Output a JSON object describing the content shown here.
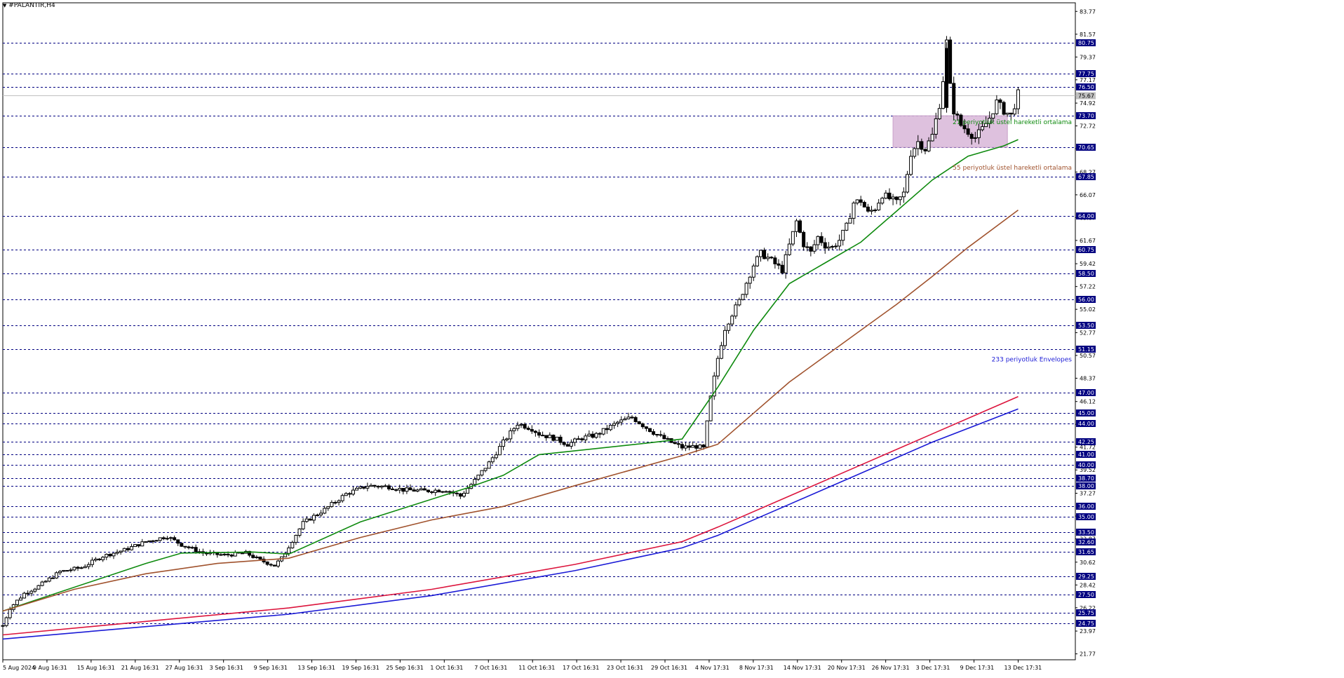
{
  "chart_data": {
    "type": "candlestick",
    "title": "#PALANTIR,H4",
    "symbol": "PALANTIR",
    "timeframe": "H4",
    "ylim": [
      21.2,
      84.6
    ],
    "y_ticks": [
      "83.77",
      "81.57",
      "79.37",
      "77.17",
      "74.92",
      "72.72",
      "70.52",
      "68.27",
      "66.07",
      "63.87",
      "61.67",
      "59.42",
      "57.22",
      "55.02",
      "52.77",
      "50.57",
      "48.37",
      "46.12",
      "43.92",
      "41.72",
      "39.52",
      "37.27",
      "35.07",
      "32.87",
      "30.62",
      "28.42",
      "26.22",
      "23.97",
      "21.77"
    ],
    "horizontal_levels": [
      "80.75",
      "77.75",
      "76.50",
      "73.70",
      "70.65",
      "67.85",
      "64.00",
      "60.75",
      "58.50",
      "56.00",
      "53.50",
      "51.15",
      "47.00",
      "45.00",
      "44.00",
      "42.25",
      "41.00",
      "40.00",
      "38.70",
      "38.00",
      "36.00",
      "35.00",
      "33.50",
      "32.60",
      "31.65",
      "29.25",
      "27.50",
      "25.75",
      "24.75"
    ],
    "current_price": "75.67",
    "x_labels": [
      "5 Aug 2024",
      "9 Aug 16:31",
      "15 Aug 16:31",
      "21 Aug 16:31",
      "27 Aug 16:31",
      "3 Sep 16:31",
      "9 Sep 16:31",
      "13 Sep 16:31",
      "19 Sep 16:31",
      "25 Sep 16:31",
      "1 Oct 16:31",
      "7 Oct 16:31",
      "11 Oct 16:31",
      "17 Oct 16:31",
      "23 Oct 16:31",
      "29 Oct 16:31",
      "4 Nov 17:31",
      "8 Nov 17:31",
      "14 Nov 17:31",
      "20 Nov 17:31",
      "26 Nov 17:31",
      "3 Dec 17:31",
      "9 Dec 17:31",
      "13 Dec 17:31"
    ],
    "price_path": [
      [
        0,
        24.5
      ],
      [
        2,
        26.2
      ],
      [
        6,
        27.6
      ],
      [
        10,
        28.3
      ],
      [
        16,
        29.7
      ],
      [
        22,
        30.1
      ],
      [
        28,
        31.2
      ],
      [
        34,
        31.8
      ],
      [
        40,
        32.6
      ],
      [
        46,
        33.1
      ],
      [
        50,
        32.3
      ],
      [
        56,
        31.5
      ],
      [
        62,
        31.3
      ],
      [
        68,
        31.5
      ],
      [
        72,
        30.8
      ],
      [
        76,
        30.3
      ],
      [
        78,
        31.0
      ],
      [
        84,
        34.4
      ],
      [
        90,
        35.7
      ],
      [
        96,
        37.2
      ],
      [
        102,
        38.0
      ],
      [
        108,
        37.9
      ],
      [
        112,
        37.6
      ],
      [
        118,
        37.5
      ],
      [
        124,
        37.6
      ],
      [
        128,
        37.0
      ],
      [
        132,
        38.5
      ],
      [
        136,
        40.2
      ],
      [
        140,
        42.2
      ],
      [
        144,
        44.0
      ],
      [
        148,
        43.5
      ],
      [
        150,
        43.0
      ],
      [
        154,
        42.6
      ],
      [
        158,
        42.0
      ],
      [
        162,
        42.6
      ],
      [
        166,
        42.9
      ],
      [
        172,
        44.1
      ],
      [
        176,
        44.6
      ],
      [
        180,
        43.6
      ],
      [
        184,
        42.7
      ],
      [
        188,
        42.0
      ],
      [
        190,
        41.7
      ],
      [
        194,
        41.8
      ],
      [
        196,
        41.6
      ],
      [
        198,
        46.5
      ],
      [
        200,
        50.3
      ],
      [
        202,
        53.2
      ],
      [
        204,
        54.6
      ],
      [
        206,
        55.8
      ],
      [
        208,
        57.6
      ],
      [
        210,
        59.3
      ],
      [
        212,
        60.4
      ],
      [
        214,
        60.0
      ],
      [
        216,
        59.4
      ],
      [
        218,
        58.8
      ],
      [
        220,
        61.2
      ],
      [
        222,
        63.5
      ],
      [
        224,
        61.3
      ],
      [
        226,
        60.5
      ],
      [
        228,
        62.0
      ],
      [
        230,
        61.2
      ],
      [
        232,
        61.0
      ],
      [
        234,
        61.7
      ],
      [
        236,
        63.0
      ],
      [
        238,
        65.3
      ],
      [
        240,
        65.5
      ],
      [
        242,
        64.3
      ],
      [
        244,
        64.8
      ],
      [
        246,
        66.1
      ],
      [
        248,
        65.7
      ],
      [
        250,
        65.3
      ],
      [
        252,
        66.2
      ],
      [
        254,
        70.1
      ],
      [
        256,
        71.2
      ],
      [
        258,
        70.5
      ],
      [
        260,
        71.8
      ],
      [
        262,
        74.8
      ],
      [
        263,
        77.2
      ],
      [
        264,
        80.8
      ],
      [
        265,
        76.5
      ],
      [
        266,
        74.2
      ],
      [
        268,
        72.8
      ],
      [
        270,
        72.2
      ],
      [
        272,
        71.6
      ],
      [
        274,
        72.4
      ],
      [
        276,
        73.5
      ],
      [
        278,
        75.0
      ],
      [
        280,
        74.2
      ],
      [
        282,
        73.7
      ],
      [
        284,
        75.8
      ]
    ],
    "series": [
      {
        "name": "21 periyotluk üstel hareketli ortalama",
        "color": "#0e8a0e",
        "x": [
          0,
          40,
          50,
          70,
          80,
          100,
          130,
          140,
          150,
          180,
          190,
          200,
          210,
          220,
          230,
          240,
          250,
          260,
          270,
          280,
          284
        ],
        "values": [
          25.9,
          30.5,
          31.5,
          31.6,
          31.4,
          34.5,
          37.8,
          39.0,
          41.0,
          42.1,
          42.5,
          47.5,
          53.0,
          57.5,
          59.5,
          61.5,
          64.5,
          67.5,
          69.8,
          70.8,
          71.4
        ]
      },
      {
        "name": "55 periyotluk üstel hareketli ortalama",
        "color": "#a0522d",
        "x": [
          0,
          20,
          40,
          60,
          80,
          100,
          120,
          140,
          160,
          190,
          200,
          210,
          220,
          230,
          240,
          250,
          260,
          270,
          284
        ],
        "values": [
          25.9,
          28.0,
          29.5,
          30.5,
          31.0,
          33.0,
          34.7,
          36.0,
          38.0,
          40.9,
          42.0,
          45.0,
          48.0,
          50.5,
          53.0,
          55.5,
          58.2,
          61.0,
          64.6
        ]
      },
      {
        "name": "233 periyotluk Envelopes",
        "color": "#dc143c",
        "x": [
          0,
          40,
          80,
          120,
          160,
          190,
          200,
          220,
          240,
          260,
          284
        ],
        "values": [
          23.6,
          24.9,
          26.2,
          28.0,
          30.4,
          32.6,
          34.0,
          37.0,
          40.0,
          43.0,
          46.6
        ]
      },
      {
        "name": "",
        "color": "#1a1ad6",
        "x": [
          0,
          40,
          80,
          120,
          160,
          190,
          200,
          220,
          240,
          260,
          284
        ],
        "values": [
          23.2,
          24.4,
          25.6,
          27.4,
          29.8,
          32.0,
          33.2,
          36.2,
          39.2,
          42.2,
          45.4
        ]
      }
    ],
    "annotations": [
      "21 periyotluk üstel hareketli ortalama",
      "55 periyotluk üstel hareketli ortalama",
      "233 periyotluk Envelopes"
    ],
    "highlight_zone": {
      "y_low": 70.65,
      "y_high": 73.7
    },
    "legend": "right, inline labels",
    "grid": false
  }
}
